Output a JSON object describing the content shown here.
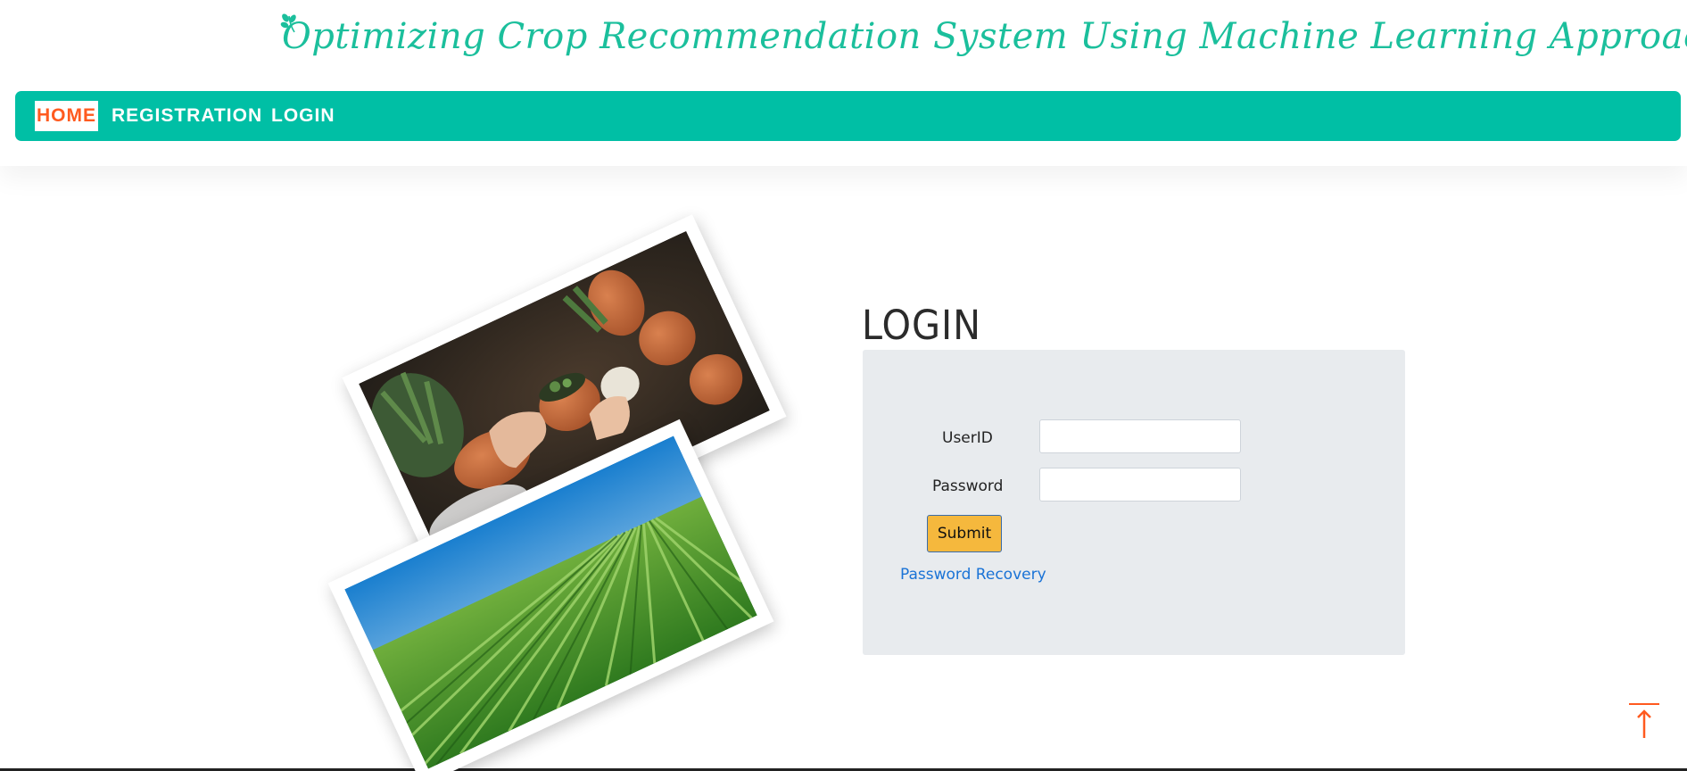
{
  "site": {
    "title": "Optimizing Crop Recommendation System Using Machine Learning Approach",
    "logo_icon": "leaf-icon",
    "accent_color": "#1bbf9c"
  },
  "nav": {
    "bar_color": "#00bfa5",
    "active_color": "#ff5a1f",
    "items": [
      {
        "label": "HOME",
        "active": true
      },
      {
        "label": "REGISTRATION",
        "active": false
      },
      {
        "label": "LOGIN",
        "active": false
      }
    ]
  },
  "images": [
    {
      "subject": "hands-potting-plants-photo"
    },
    {
      "subject": "green-crop-field-photo"
    }
  ],
  "login": {
    "title": "LOGIN",
    "userid_label": "UserID",
    "userid_value": "",
    "password_label": "Password",
    "password_value": "",
    "submit_label": "Submit",
    "recovery_label": "Password Recovery"
  },
  "back_to_top": {
    "icon": "arrow-up-icon",
    "color": "#ff5a1f"
  }
}
